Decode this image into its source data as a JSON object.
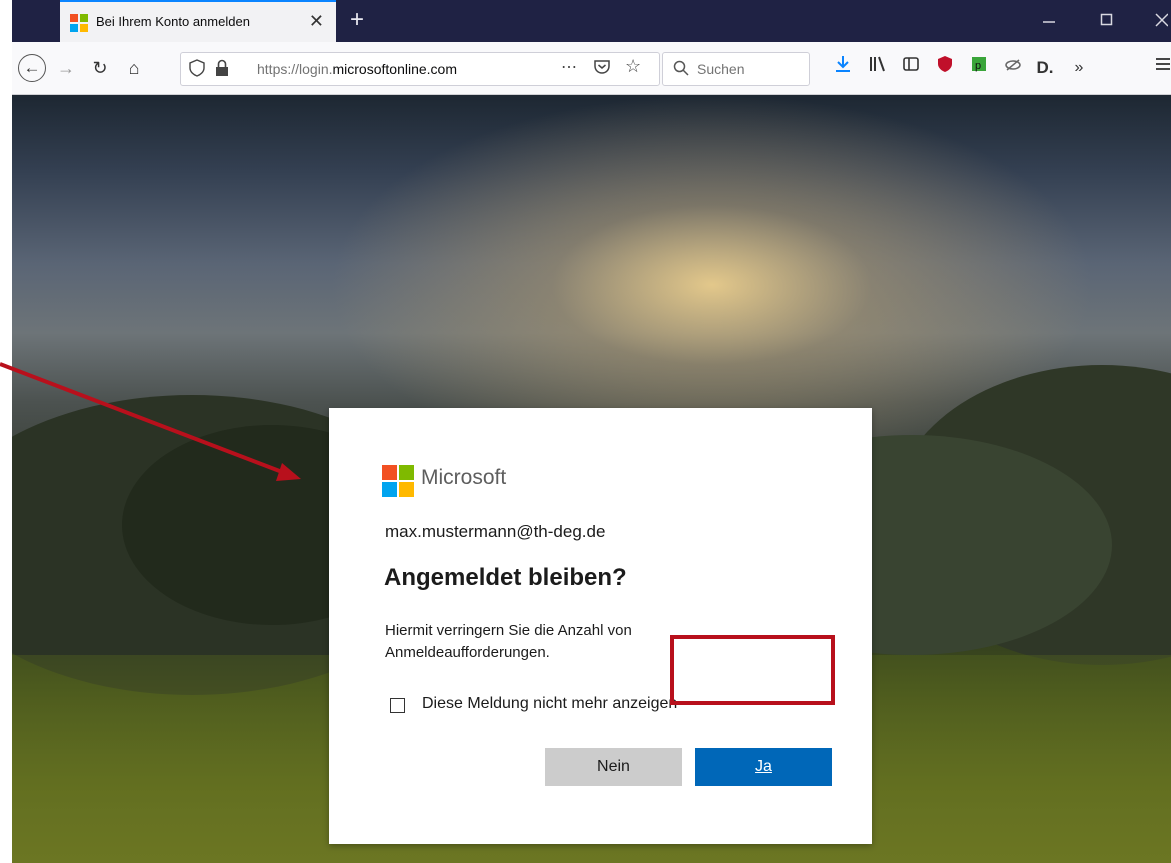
{
  "browser": {
    "tab_title": "Bei Ihrem Konto anmelden",
    "tab_close": "✕",
    "new_tab": "+",
    "url_prefix": "https://login.",
    "url_domain": "microsoftonline.com",
    "search_placeholder": "Suchen",
    "icons": [
      "back-icon",
      "forward-icon",
      "reload-icon",
      "home-icon",
      "shield-icon",
      "lock-icon",
      "page-actions-icon",
      "pocket-icon",
      "bookmark-star-icon",
      "search-icon",
      "download-icon",
      "library-icon",
      "sidebar-icon",
      "ublock-icon",
      "extension-p-icon",
      "extension-bird-icon",
      "extension-d-icon",
      "overflow-icon",
      "menu-icon"
    ]
  },
  "dialog": {
    "brand": "Microsoft",
    "account": "max.mustermann@th-deg.de",
    "title": "Angemeldet bleiben?",
    "description": "Hiermit verringern Sie die Anzahl von Anmeldeaufforderungen.",
    "checkbox_label": "Diese Meldung nicht mehr anzeigen",
    "checkbox_checked": false,
    "no_label": "Nein",
    "yes_label": "Ja"
  },
  "colors": {
    "primary_button": "#0067b8",
    "secondary_button": "#cccccc",
    "annotation": "#b8101c",
    "ms_red": "#f25022",
    "ms_green": "#7fba00",
    "ms_blue": "#00a4ef",
    "ms_yellow": "#ffb900"
  }
}
